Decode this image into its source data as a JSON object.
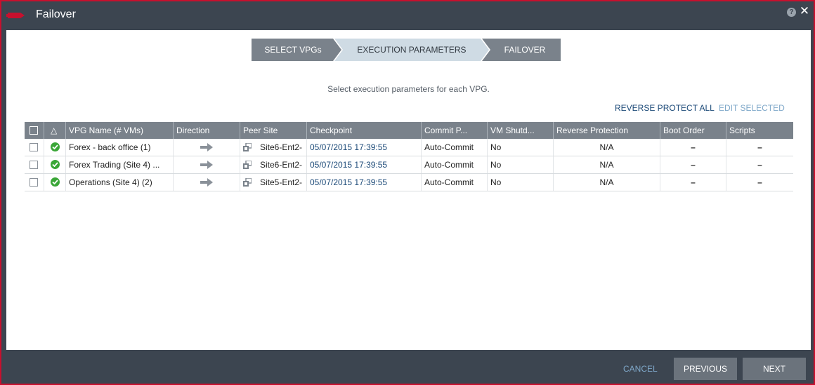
{
  "window": {
    "title": "Failover",
    "help_glyph": "?",
    "close_glyph": "✕"
  },
  "colors": {
    "accent_red": "#c8102e",
    "chrome": "#3c4550",
    "step_active": "#cfdbe4",
    "step_inactive": "#7a828b",
    "link": "#1c4a78",
    "link_disabled": "#7fa8c9",
    "status_ok": "#3aa637"
  },
  "steps": [
    {
      "label": "SELECT VPGs",
      "state": "done"
    },
    {
      "label": "EXECUTION PARAMETERS",
      "state": "active"
    },
    {
      "label": "FAILOVER",
      "state": "pending"
    }
  ],
  "instructions": "Select execution parameters for each VPG.",
  "actions": {
    "reverse_protect_all": "REVERSE PROTECT ALL",
    "edit_selected": "EDIT SELECTED"
  },
  "table": {
    "columns": {
      "status_glyph": "△",
      "name": "VPG Name (# VMs)",
      "direction": "Direction",
      "peer_site": "Peer Site",
      "checkpoint": "Checkpoint",
      "commit": "Commit P...",
      "vm_shutdown": "VM Shutd...",
      "reverse_protection": "Reverse Protection",
      "boot_order": "Boot Order",
      "scripts": "Scripts"
    },
    "rows": [
      {
        "name": "Forex - back office (1)",
        "status": "ok-icon",
        "direction": "arrow-right-icon",
        "peer_site": "Site6-Ent2-",
        "checkpoint": "05/07/2015 17:39:55",
        "commit": "Auto-Commit",
        "vm_shutdown": "No",
        "reverse_protection": "N/A",
        "boot_order": "–",
        "scripts": "–"
      },
      {
        "name": "Forex Trading (Site 4) ...",
        "status": "ok-icon",
        "direction": "arrow-right-icon",
        "peer_site": "Site6-Ent2-",
        "checkpoint": "05/07/2015 17:39:55",
        "commit": "Auto-Commit",
        "vm_shutdown": "No",
        "reverse_protection": "N/A",
        "boot_order": "–",
        "scripts": "–"
      },
      {
        "name": "Operations (Site 4) (2)",
        "status": "ok-icon",
        "direction": "arrow-right-icon",
        "peer_site": "Site5-Ent2-",
        "checkpoint": "05/07/2015 17:39:55",
        "commit": "Auto-Commit",
        "vm_shutdown": "No",
        "reverse_protection": "N/A",
        "boot_order": "–",
        "scripts": "–"
      }
    ]
  },
  "footer": {
    "cancel": "CANCEL",
    "previous": "PREVIOUS",
    "next": "NEXT"
  }
}
